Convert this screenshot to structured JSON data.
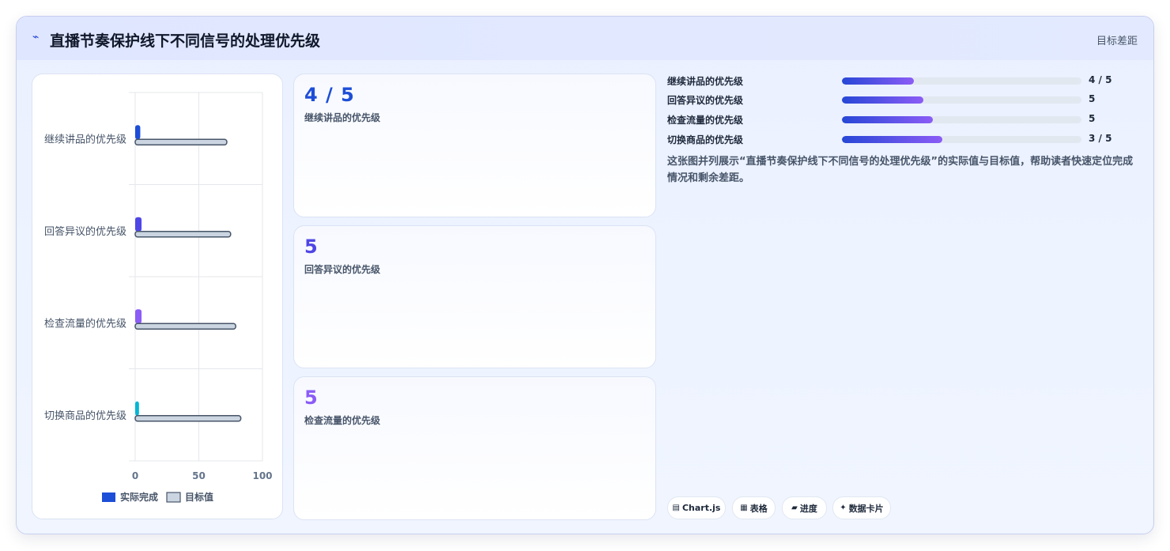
{
  "header": {
    "title": "直播节奏保护线下不同信号的处理优先级",
    "title_icon": "lightning-icon",
    "right_label": "目标差距"
  },
  "chart_data": {
    "type": "bar",
    "orientation": "horizontal",
    "categories": [
      "继续讲品的优先级",
      "回答异议的优先级",
      "检查流量的优先级",
      "切换商品的优先级"
    ],
    "series": [
      {
        "name": "实际完成",
        "values": [
          4,
          5,
          5,
          3
        ],
        "colors": [
          "#1d4ed8",
          "#4f46e5",
          "#8b5cf6",
          "#06b6d4"
        ]
      },
      {
        "name": "目标值",
        "values": [
          72,
          75,
          79,
          83
        ],
        "color": "#cbd5e1",
        "stroke": "#475569"
      }
    ],
    "xlim": [
      0,
      100
    ],
    "xticks": [
      "0",
      "50",
      "100"
    ],
    "grid": true,
    "legend": "bottom"
  },
  "stats": [
    {
      "value": "4 / 5",
      "label": "继续讲品的优先级",
      "color": "#1d4ed8"
    },
    {
      "value": "5",
      "label": "回答异议的优先级",
      "color": "#4f46e5"
    },
    {
      "value": "5",
      "label": "检查流量的优先级",
      "color": "#8b5cf6"
    }
  ],
  "progress": [
    {
      "label": "继续讲品的优先级",
      "value": "4 / 5",
      "fill": 0.3
    },
    {
      "label": "回答异议的优先级",
      "value": "5",
      "fill": 0.34
    },
    {
      "label": "检查流量的优先级",
      "value": "5",
      "fill": 0.38
    },
    {
      "label": "切换商品的优先级",
      "value": "3 / 5",
      "fill": 0.42
    }
  ],
  "description": "这张图并列展示“直播节奏保护线下不同信号的处理优先级”的实际值与目标值，帮助读者快速定位完成情况和剩余差距。",
  "chips": [
    {
      "icon": "chart-icon",
      "glyph": "▤",
      "label": "Chart.js"
    },
    {
      "icon": "table-icon",
      "glyph": "▦",
      "label": "表格"
    },
    {
      "icon": "progress-icon",
      "glyph": "▰",
      "label": "进度"
    },
    {
      "icon": "sparkle-icon",
      "glyph": "✦",
      "label": "数据卡片"
    }
  ]
}
